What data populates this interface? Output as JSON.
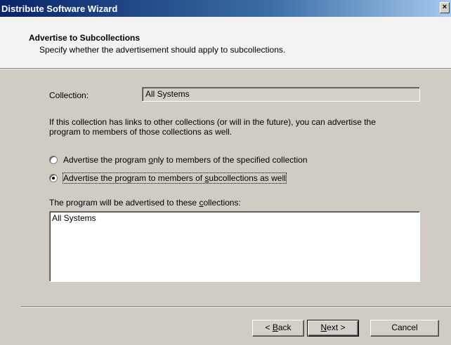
{
  "window": {
    "title": "Distribute Software Wizard",
    "close_glyph": "×"
  },
  "header": {
    "title": "Advertise to Subcollections",
    "subtitle": "Specify whether the advertisement should apply to subcollections."
  },
  "collection": {
    "label": "Collection:",
    "value": "All Systems"
  },
  "info_line1": "If this collection has links to other collections (or will in the future), you can advertise the",
  "info_line2": "program to members of those collections as well.",
  "options": [
    {
      "pre": "Advertise the program ",
      "accel": "o",
      "post": "nly to members of the specified collection",
      "checked": false
    },
    {
      "pre": "Advertise the program to members of ",
      "accel": "s",
      "post": "ubcollections as well",
      "checked": true
    }
  ],
  "list": {
    "label_pre": "The program will be advertised to these ",
    "label_accel": "c",
    "label_post": "ollections:",
    "items": [
      "All Systems"
    ]
  },
  "buttons": {
    "back": {
      "pre": "< ",
      "accel": "B",
      "post": "ack"
    },
    "next": {
      "pre": "",
      "accel": "N",
      "post": "ext >"
    },
    "cancel": "Cancel"
  }
}
